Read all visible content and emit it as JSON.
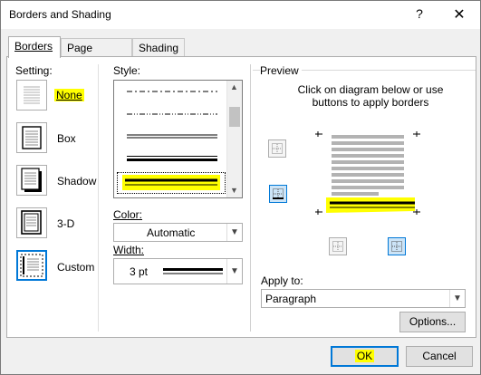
{
  "dialog": {
    "title": "Borders and Shading",
    "help_label": "?",
    "close_label": "✕"
  },
  "tabs": [
    {
      "label": "Borders",
      "active": true
    },
    {
      "label": "Page Border",
      "active": false
    },
    {
      "label": "Shading",
      "active": false
    }
  ],
  "setting": {
    "label": "Setting:",
    "options": [
      {
        "label": "None",
        "selected": false,
        "highlighted": true,
        "icon": "setting-none-icon"
      },
      {
        "label": "Box",
        "selected": false,
        "icon": "setting-box-icon"
      },
      {
        "label": "Shadow",
        "selected": false,
        "icon": "setting-shadow-icon"
      },
      {
        "label": "3-D",
        "selected": false,
        "icon": "setting-3d-icon"
      },
      {
        "label": "Custom",
        "selected": true,
        "icon": "setting-custom-icon"
      }
    ]
  },
  "style": {
    "label": "Style:",
    "items": [
      "dash-dot",
      "dash-dot-dot",
      "double",
      "thick-thin"
    ],
    "selected": "thick-thin"
  },
  "color": {
    "label": "Color:",
    "value": "Automatic"
  },
  "width": {
    "label": "Width:",
    "value": "3 pt"
  },
  "preview": {
    "label": "Preview",
    "instructions": "Click on diagram below or use buttons to apply borders"
  },
  "apply_to": {
    "label": "Apply to:",
    "value": "Paragraph"
  },
  "buttons": {
    "options": "Options...",
    "ok": "OK",
    "cancel": "Cancel"
  },
  "colors": {
    "accent": "#0078d7",
    "highlight": "#ffff00",
    "panel_bg": "#ffffff",
    "dialog_bg": "#f0f0f0"
  }
}
